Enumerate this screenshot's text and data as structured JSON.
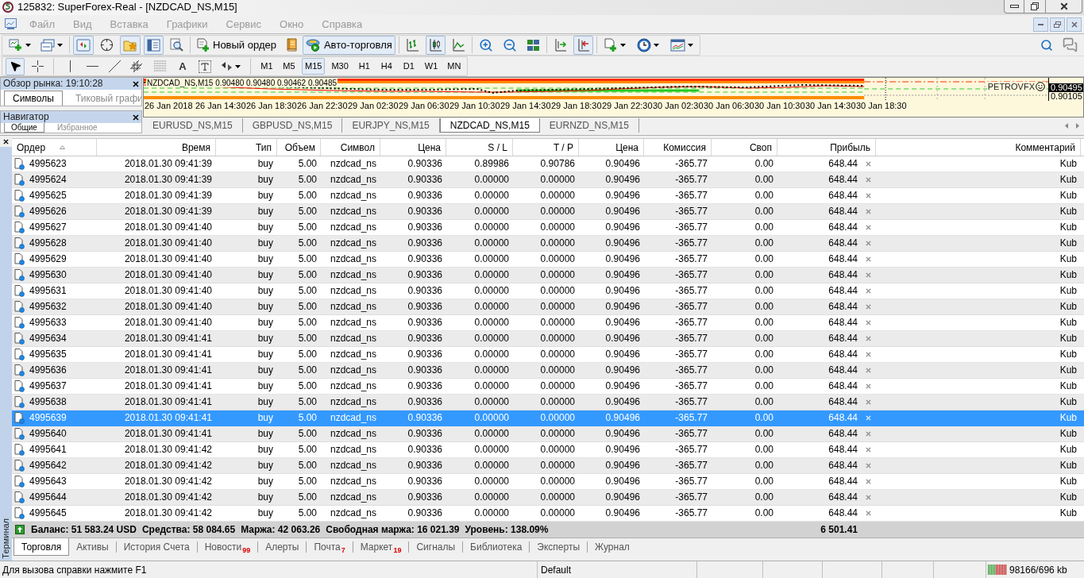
{
  "window": {
    "title": "125832: SuperForex-Real - [NZDCAD_NS,M15]"
  },
  "menu": [
    "Файл",
    "Вид",
    "Вставка",
    "Графики",
    "Сервис",
    "Окно",
    "Справка"
  ],
  "toolbar": {
    "panels": [
      {
        "kind": "market_watch",
        "on": true
      },
      {
        "kind": "data_window",
        "on": false
      },
      {
        "kind": "navigator",
        "on": true
      },
      {
        "kind": "terminal",
        "on": true
      },
      {
        "kind": "tester",
        "on": false
      }
    ],
    "new_order": "Новый ордер",
    "auto_trading": {
      "label": "Авто-торговля",
      "on": true
    },
    "chart_modes": [
      {
        "kind": "bars",
        "selected": false
      },
      {
        "kind": "candles",
        "selected": true
      },
      {
        "kind": "line",
        "selected": false
      }
    ],
    "auto_scroll": {
      "on": false
    },
    "chart_shift": {
      "on": true
    }
  },
  "drawing_tools": [
    {
      "kind": "cursor",
      "selected": true
    },
    {
      "kind": "crosshair",
      "selected": false
    },
    {
      "kind": "vline",
      "selected": false
    },
    {
      "kind": "hline",
      "selected": false
    },
    {
      "kind": "trend",
      "selected": false
    },
    {
      "kind": "channel",
      "selected": false
    },
    {
      "kind": "fibo",
      "selected": false
    },
    {
      "kind": "text",
      "label": "A",
      "selected": false
    },
    {
      "kind": "label",
      "selected": false
    },
    {
      "kind": "arrows",
      "selected": false
    }
  ],
  "timeframes": [
    {
      "label": "M1",
      "selected": false
    },
    {
      "label": "M5",
      "selected": false
    },
    {
      "label": "M15",
      "selected": true
    },
    {
      "label": "M30",
      "selected": false
    },
    {
      "label": "H1",
      "selected": false
    },
    {
      "label": "H4",
      "selected": false
    },
    {
      "label": "D1",
      "selected": false
    },
    {
      "label": "W1",
      "selected": false
    },
    {
      "label": "MN",
      "selected": false
    }
  ],
  "market_watch": {
    "title": "Обзор рынка: 19:10:28",
    "tabs": [
      {
        "label": "Символы",
        "selected": true
      },
      {
        "label": "Тиковый графи",
        "selected": false
      }
    ]
  },
  "navigator": {
    "title": "Навигатор",
    "tabs": [
      {
        "label": "Общие",
        "selected": true
      },
      {
        "label": "Избранное",
        "selected": false
      }
    ]
  },
  "chart": {
    "heading": "NZDCAD_NS,M15 0.90480 0.90480 0.90462 0.90485",
    "signature": "PETROVFX",
    "price_labels": [
      {
        "label": "0.90495",
        "current": true
      },
      {
        "label": "0.90105",
        "current": false
      }
    ],
    "time_labels": [
      "26 Jan 2018",
      "26 Jan 14:30",
      "26 Jan 18:30",
      "26 Jan 22:30",
      "29 Jan 02:30",
      "29 Jan 06:30",
      "29 Jan 10:30",
      "29 Jan 14:30",
      "29 Jan 18:30",
      "29 Jan 22:30",
      "30 Jan 02:30",
      "30 Jan 06:30",
      "30 Jan 10:30",
      "30 Jan 14:30",
      "30 Jan 18:30"
    ]
  },
  "chart_tabs": [
    {
      "label": "EURUSD_NS,M15",
      "selected": false
    },
    {
      "label": "GBPUSD_NS,M15",
      "selected": false
    },
    {
      "label": "EURJPY_NS,M15",
      "selected": false
    },
    {
      "label": "NZDCAD_NS,M15",
      "selected": true
    },
    {
      "label": "EURNZD_NS,M15",
      "selected": false
    }
  ],
  "terminal": {
    "title": "Терминал",
    "columns": [
      {
        "label": "Ордер",
        "sorted": true
      },
      {
        "label": "Время",
        "sorted": false
      },
      {
        "label": "Тип",
        "sorted": false
      },
      {
        "label": "Объем",
        "sorted": false
      },
      {
        "label": "Символ",
        "sorted": false
      },
      {
        "label": "Цена",
        "sorted": false
      },
      {
        "label": "S / L",
        "sorted": false
      },
      {
        "label": "T / P",
        "sorted": false
      },
      {
        "label": "Цена",
        "sorted": false
      },
      {
        "label": "Комиссия",
        "sorted": false
      },
      {
        "label": "Своп",
        "sorted": false
      },
      {
        "label": "Прибыль",
        "sorted": false
      },
      {
        "label": "Комментарий",
        "sorted": false
      }
    ],
    "rows": [
      {
        "selected": false,
        "cells": [
          "4995623",
          "2018.01.30 09:41:39",
          "buy",
          "5.00",
          "nzdcad_ns",
          "0.90336",
          "0.89986",
          "0.90786",
          "0.90496",
          "-365.77",
          "0.00",
          "648.44",
          "Kub"
        ]
      },
      {
        "selected": false,
        "cells": [
          "4995624",
          "2018.01.30 09:41:39",
          "buy",
          "5.00",
          "nzdcad_ns",
          "0.90336",
          "0.00000",
          "0.00000",
          "0.90496",
          "-365.77",
          "0.00",
          "648.44",
          "Kub"
        ]
      },
      {
        "selected": false,
        "cells": [
          "4995625",
          "2018.01.30 09:41:39",
          "buy",
          "5.00",
          "nzdcad_ns",
          "0.90336",
          "0.00000",
          "0.00000",
          "0.90496",
          "-365.77",
          "0.00",
          "648.44",
          "Kub"
        ]
      },
      {
        "selected": false,
        "cells": [
          "4995626",
          "2018.01.30 09:41:39",
          "buy",
          "5.00",
          "nzdcad_ns",
          "0.90336",
          "0.00000",
          "0.00000",
          "0.90496",
          "-365.77",
          "0.00",
          "648.44",
          "Kub"
        ]
      },
      {
        "selected": false,
        "cells": [
          "4995627",
          "2018.01.30 09:41:40",
          "buy",
          "5.00",
          "nzdcad_ns",
          "0.90336",
          "0.00000",
          "0.00000",
          "0.90496",
          "-365.77",
          "0.00",
          "648.44",
          "Kub"
        ]
      },
      {
        "selected": false,
        "cells": [
          "4995628",
          "2018.01.30 09:41:40",
          "buy",
          "5.00",
          "nzdcad_ns",
          "0.90336",
          "0.00000",
          "0.00000",
          "0.90496",
          "-365.77",
          "0.00",
          "648.44",
          "Kub"
        ]
      },
      {
        "selected": false,
        "cells": [
          "4995629",
          "2018.01.30 09:41:40",
          "buy",
          "5.00",
          "nzdcad_ns",
          "0.90336",
          "0.00000",
          "0.00000",
          "0.90496",
          "-365.77",
          "0.00",
          "648.44",
          "Kub"
        ]
      },
      {
        "selected": false,
        "cells": [
          "4995630",
          "2018.01.30 09:41:40",
          "buy",
          "5.00",
          "nzdcad_ns",
          "0.90336",
          "0.00000",
          "0.00000",
          "0.90496",
          "-365.77",
          "0.00",
          "648.44",
          "Kub"
        ]
      },
      {
        "selected": false,
        "cells": [
          "4995631",
          "2018.01.30 09:41:40",
          "buy",
          "5.00",
          "nzdcad_ns",
          "0.90336",
          "0.00000",
          "0.00000",
          "0.90496",
          "-365.77",
          "0.00",
          "648.44",
          "Kub"
        ]
      },
      {
        "selected": false,
        "cells": [
          "4995632",
          "2018.01.30 09:41:40",
          "buy",
          "5.00",
          "nzdcad_ns",
          "0.90336",
          "0.00000",
          "0.00000",
          "0.90496",
          "-365.77",
          "0.00",
          "648.44",
          "Kub"
        ]
      },
      {
        "selected": false,
        "cells": [
          "4995633",
          "2018.01.30 09:41:40",
          "buy",
          "5.00",
          "nzdcad_ns",
          "0.90336",
          "0.00000",
          "0.00000",
          "0.90496",
          "-365.77",
          "0.00",
          "648.44",
          "Kub"
        ]
      },
      {
        "selected": false,
        "cells": [
          "4995634",
          "2018.01.30 09:41:41",
          "buy",
          "5.00",
          "nzdcad_ns",
          "0.90336",
          "0.00000",
          "0.00000",
          "0.90496",
          "-365.77",
          "0.00",
          "648.44",
          "Kub"
        ]
      },
      {
        "selected": false,
        "cells": [
          "4995635",
          "2018.01.30 09:41:41",
          "buy",
          "5.00",
          "nzdcad_ns",
          "0.90336",
          "0.00000",
          "0.00000",
          "0.90496",
          "-365.77",
          "0.00",
          "648.44",
          "Kub"
        ]
      },
      {
        "selected": false,
        "cells": [
          "4995636",
          "2018.01.30 09:41:41",
          "buy",
          "5.00",
          "nzdcad_ns",
          "0.90336",
          "0.00000",
          "0.00000",
          "0.90496",
          "-365.77",
          "0.00",
          "648.44",
          "Kub"
        ]
      },
      {
        "selected": false,
        "cells": [
          "4995637",
          "2018.01.30 09:41:41",
          "buy",
          "5.00",
          "nzdcad_ns",
          "0.90336",
          "0.00000",
          "0.00000",
          "0.90496",
          "-365.77",
          "0.00",
          "648.44",
          "Kub"
        ]
      },
      {
        "selected": false,
        "cells": [
          "4995638",
          "2018.01.30 09:41:41",
          "buy",
          "5.00",
          "nzdcad_ns",
          "0.90336",
          "0.00000",
          "0.00000",
          "0.90496",
          "-365.77",
          "0.00",
          "648.44",
          "Kub"
        ]
      },
      {
        "selected": true,
        "cells": [
          "4995639",
          "2018.01.30 09:41:41",
          "buy",
          "5.00",
          "nzdcad_ns",
          "0.90336",
          "0.00000",
          "0.00000",
          "0.90496",
          "-365.77",
          "0.00",
          "648.44",
          "Kub"
        ]
      },
      {
        "selected": false,
        "cells": [
          "4995640",
          "2018.01.30 09:41:41",
          "buy",
          "5.00",
          "nzdcad_ns",
          "0.90336",
          "0.00000",
          "0.00000",
          "0.90496",
          "-365.77",
          "0.00",
          "648.44",
          "Kub"
        ]
      },
      {
        "selected": false,
        "cells": [
          "4995641",
          "2018.01.30 09:41:42",
          "buy",
          "5.00",
          "nzdcad_ns",
          "0.90336",
          "0.00000",
          "0.00000",
          "0.90496",
          "-365.77",
          "0.00",
          "648.44",
          "Kub"
        ]
      },
      {
        "selected": false,
        "cells": [
          "4995642",
          "2018.01.30 09:41:42",
          "buy",
          "5.00",
          "nzdcad_ns",
          "0.90336",
          "0.00000",
          "0.00000",
          "0.90496",
          "-365.77",
          "0.00",
          "648.44",
          "Kub"
        ]
      },
      {
        "selected": false,
        "cells": [
          "4995643",
          "2018.01.30 09:41:42",
          "buy",
          "5.00",
          "nzdcad_ns",
          "0.90336",
          "0.00000",
          "0.00000",
          "0.90496",
          "-365.77",
          "0.00",
          "648.44",
          "Kub"
        ]
      },
      {
        "selected": false,
        "cells": [
          "4995644",
          "2018.01.30 09:41:42",
          "buy",
          "5.00",
          "nzdcad_ns",
          "0.90336",
          "0.00000",
          "0.00000",
          "0.90496",
          "-365.77",
          "0.00",
          "648.44",
          "Kub"
        ]
      },
      {
        "selected": false,
        "cells": [
          "4995645",
          "2018.01.30 09:41:42",
          "buy",
          "5.00",
          "nzdcad_ns",
          "0.90336",
          "0.00000",
          "0.00000",
          "0.90496",
          "-365.77",
          "0.00",
          "648.44",
          "Kub"
        ]
      }
    ],
    "summary": {
      "items": [
        "Баланс: 51 583.24 USD",
        "Средства: 58 084.65",
        "Маржа: 42 063.26",
        "Свободная маржа: 16 021.39",
        "Уровень: 138.09%"
      ],
      "profit": "6 501.41"
    },
    "tabs": [
      {
        "label": "Торговля",
        "selected": true
      },
      {
        "label": "Активы",
        "selected": false
      },
      {
        "label": "История Счета",
        "selected": false
      },
      {
        "label": "Новости",
        "badge": "99",
        "selected": false
      },
      {
        "label": "Алерты",
        "selected": false
      },
      {
        "label": "Почта",
        "badge": "7",
        "selected": false
      },
      {
        "label": "Маркет",
        "badge": "19",
        "selected": false
      },
      {
        "label": "Сигналы",
        "selected": false
      },
      {
        "label": "Библиотека",
        "selected": false
      },
      {
        "label": "Эксперты",
        "selected": false
      },
      {
        "label": "Журнал",
        "selected": false
      }
    ]
  },
  "status_bar": {
    "help": "Для вызова справки нажмите F1",
    "profile": "Default",
    "traffic": "98166/696 kb"
  }
}
